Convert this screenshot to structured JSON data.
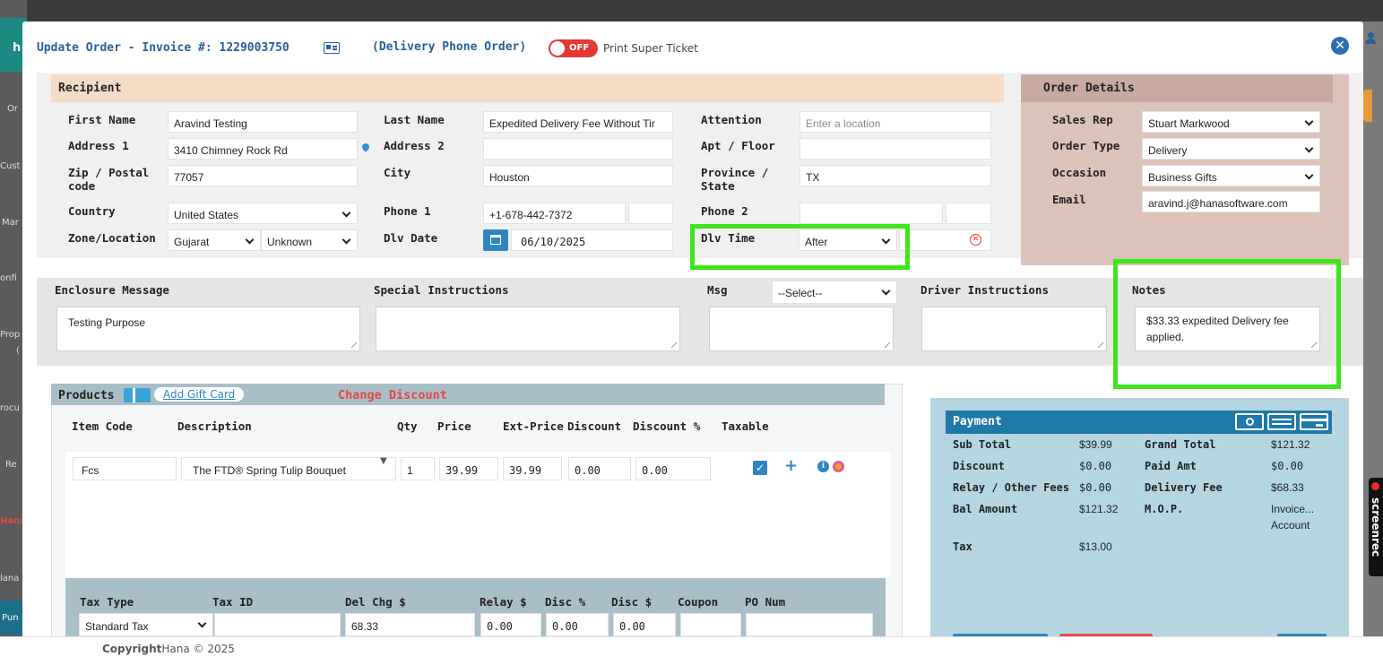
{
  "header": {
    "title_prefix": "Update Order",
    "title_invoice": " - Invoice #: 1229003750",
    "order_kind": "(Delivery Phone Order)",
    "toggle_label": "OFF",
    "print_label": "Print Super Ticket"
  },
  "sidebar": {
    "items": [
      "h",
      "Or",
      "Cust",
      "Mar",
      "onfi",
      "Prop",
      "(",
      "rocu",
      "Re",
      "Hana",
      "lana",
      "Pun"
    ]
  },
  "recipient": {
    "section_title": "Recipient",
    "first_name_label": "First Name",
    "first_name": "Aravind Testing",
    "last_name_label": "Last Name",
    "last_name": "Expedited Delivery Fee Without Tir",
    "attention_label": "Attention",
    "attention_placeholder": "Enter a location",
    "address1_label": "Address 1",
    "address1": "3410 Chimney Rock Rd",
    "address2_label": "Address 2",
    "address2": "",
    "apt_label": "Apt / Floor",
    "apt": "",
    "zip_label": "Zip / Postal code",
    "zip": "77057",
    "city_label": "City",
    "city": "Houston",
    "province_label": "Province / State",
    "province": "TX",
    "country_label": "Country",
    "country": "United States",
    "phone1_label": "Phone 1",
    "phone1": "+1-678-442-7372",
    "phone2_label": "Phone 2",
    "zone_label": "Zone/Location",
    "zone": "Gujarat",
    "zone2": "Unknown",
    "dlv_date_label": "Dlv Date",
    "dlv_date": "06/10/2025",
    "dlv_time_label": "Dlv Time",
    "dlv_time": "After"
  },
  "order_details": {
    "section_title": "Order Details",
    "sales_rep_label": "Sales Rep",
    "sales_rep": "Stuart Markwood",
    "order_type_label": "Order Type",
    "order_type": "Delivery",
    "occasion_label": "Occasion",
    "occasion": "Business Gifts",
    "email_label": "Email",
    "email": "aravind.j@hanasoftware.com"
  },
  "messages": {
    "enclosure_label": "Enclosure Message",
    "enclosure": "Testing Purpose",
    "special_label": "Special Instructions",
    "msg_label": "Msg",
    "msg_select": "--Select--",
    "driver_label": "Driver Instructions",
    "notes_label": "Notes",
    "notes": "$33.33 expedited Delivery fee applied."
  },
  "products": {
    "section_title": "Products",
    "add_gift_card": "Add Gift Card",
    "change_discount": "Change Discount",
    "columns": [
      "Item Code",
      "Description",
      "Qty",
      "Price",
      "Ext-Price",
      "Discount",
      "Discount %",
      "Taxable"
    ],
    "row": {
      "item_code": "Fcs",
      "description": "The FTD® Spring Tulip Bouquet",
      "qty": "1",
      "price": "39.99",
      "ext_price": "39.99",
      "discount": "0.00",
      "discount_pct": "0.00"
    },
    "tax": {
      "labels": [
        "Tax Type",
        "Tax ID",
        "Del Chg $",
        "Relay $",
        "Disc %",
        "Disc $",
        "Coupon",
        "PO Num"
      ],
      "tax_type": "Standard Tax",
      "del_chg": "68.33",
      "relay": "0.00",
      "disc_pct": "0.00",
      "disc_amt": "0.00"
    }
  },
  "payment": {
    "title": "Payment",
    "sub_total_label": "Sub Total",
    "sub_total": "$39.99",
    "grand_total_label": "Grand Total",
    "grand_total": "$121.32",
    "discount_label": "Discount",
    "discount": "$0.00",
    "paid_label": "Paid Amt",
    "paid": "$0.00",
    "relay_label": "Relay / Other Fees",
    "relay": "$0.00",
    "delivery_fee_label": "Delivery Fee",
    "delivery_fee": "$68.33",
    "bal_label": "Bal Amount",
    "bal": "$121.32",
    "mop_label": "M.O.P.",
    "mop_line1": "Invoice...",
    "mop_line2": "Account",
    "tax_label": "Tax",
    "tax": "$13.00"
  },
  "footer": {
    "copyright_bold": "Copyright",
    "copyright_rest": "Hana © 2025"
  },
  "screenrec": "screenrec",
  "colors": {
    "title_blue": "#2b5f95",
    "recipient_bg": "#f5dcc6",
    "order_details_bg": "#dcc3ba",
    "payment_bg": "#b5d6e0",
    "payment_header": "#1f79a8",
    "products_header": "#a9bfc8",
    "highlight": "#3ee51a",
    "change_discount": "#e24646"
  }
}
